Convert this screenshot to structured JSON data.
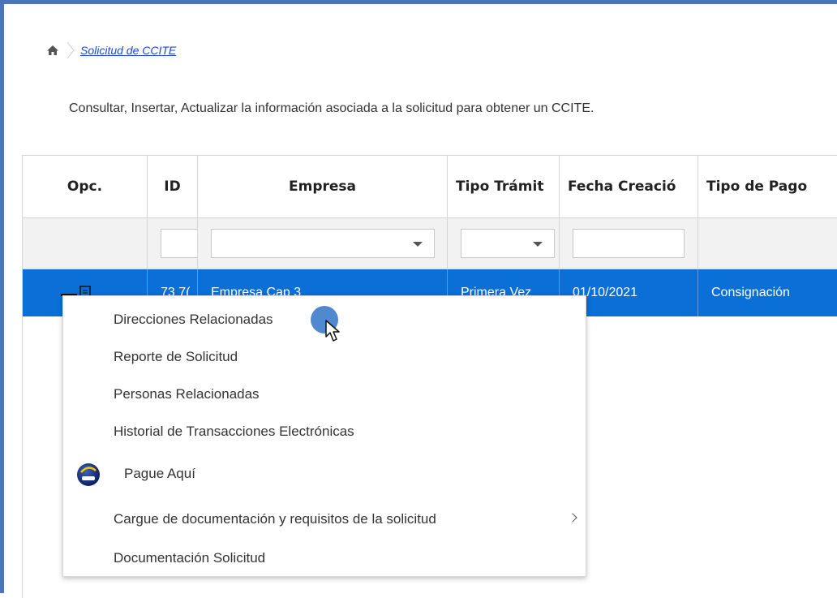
{
  "breadcrumb": {
    "link": "Solicitud de CCITE"
  },
  "description": "Consultar, Insertar, Actualizar la información asociada a la solicitud para obtener un CCITE.",
  "grid": {
    "headers": {
      "opc": "Opc.",
      "id": "ID",
      "empresa": "Empresa",
      "tipo_tramite": "Tipo Trámit",
      "fecha_creacion": "Fecha Creació",
      "tipo_pago": "Tipo de Pago"
    },
    "rows": [
      {
        "id": "73 7(",
        "empresa": "Empresa Cap 3",
        "tipo_tramite": "Primera Vez",
        "fecha_creacion": "01/10/2021",
        "tipo_pago": "Consignación"
      }
    ],
    "selected_row_color": "#0a6fd6"
  },
  "context_menu": {
    "items": [
      {
        "label": "Direcciones Relacionadas"
      },
      {
        "label": "Reporte de Solicitud"
      },
      {
        "label": "Personas Relacionadas"
      },
      {
        "label": "Historial de Transacciones Electrónicas"
      },
      {
        "label": "Pague Aquí",
        "icon": "pse-icon"
      },
      {
        "label": "Cargue de documentación y requisitos de la solicitud",
        "has_submenu": true
      },
      {
        "label": "Documentación Solicitud"
      }
    ]
  },
  "colors": {
    "accent": "#4a76b8",
    "link": "#1a47e0",
    "selection": "#0a6fd6"
  }
}
